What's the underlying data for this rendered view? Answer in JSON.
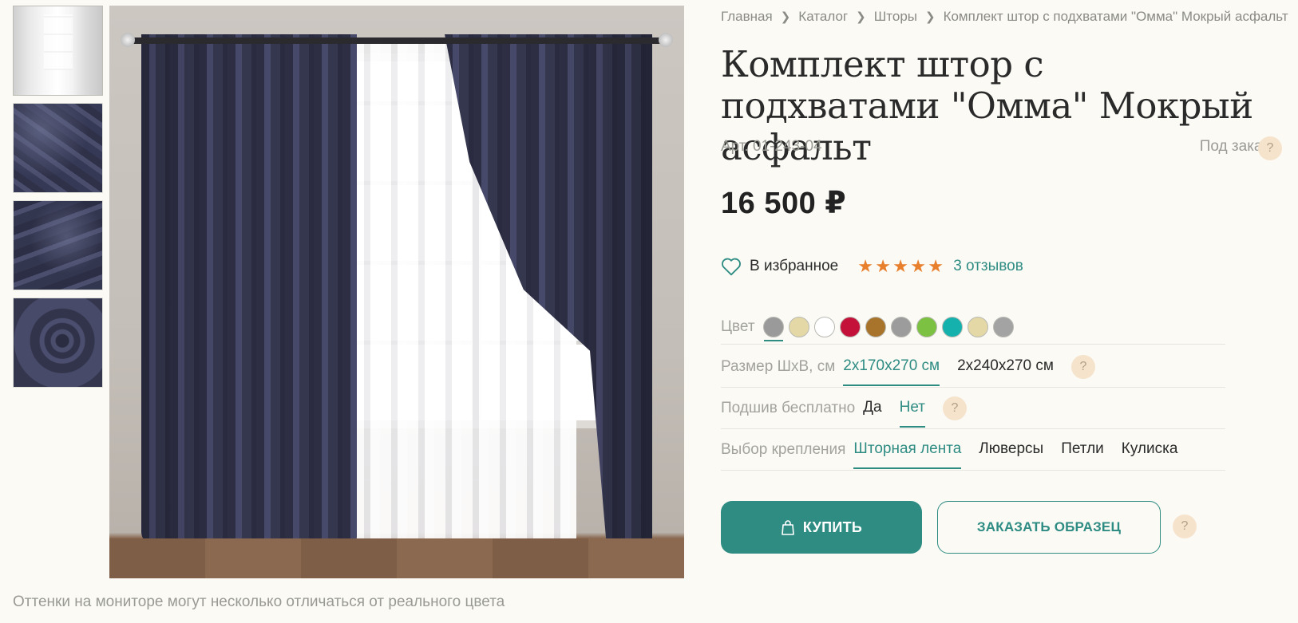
{
  "notice": "Оттенки на мониторе могут несколько отличаться от реального цвета",
  "breadcrumb": [
    {
      "label": "Главная"
    },
    {
      "label": "Каталог"
    },
    {
      "label": "Шторы"
    },
    {
      "label": "Комплект штор с подхватами \"Омма\" Мокрый асфальт"
    }
  ],
  "product": {
    "title": "Комплект штор с подхватами \"Омма\" Мокрый асфальт",
    "sku": "Арт. 01-243-04",
    "availability": "Под заказ",
    "price": "16 500 ₽",
    "favorite_label": "В избранное",
    "rating": 5,
    "reviews_label": "3 отзывов"
  },
  "help_glyph": "?",
  "options": {
    "color": {
      "label": "Цвет",
      "swatches": [
        "#9a9a9a",
        "#e4d8a6",
        "#ffffff",
        "#c3113a",
        "#a8742c",
        "#9c9c9c",
        "#7cc142",
        "#15b2ad",
        "#e4d8a6",
        "#a3a3a3"
      ]
    },
    "size": {
      "label": "Размер ШхВ, см",
      "values": [
        "2х170х270 см",
        "2х240х270 см"
      ],
      "selected": 0
    },
    "hem": {
      "label": "Подшив бесплатно",
      "values": [
        "Да",
        "Нет"
      ],
      "selected": 1
    },
    "mount": {
      "label": "Выбор крепления",
      "values": [
        "Шторная лента",
        "Люверсы",
        "Петли",
        "Кулиска"
      ],
      "selected": 0
    }
  },
  "actions": {
    "buy_label": "КУПИТЬ",
    "sample_label": "ЗАКАЗАТЬ ОБРАЗЕЦ"
  },
  "colors": {
    "accent": "#2e8c83",
    "star": "#e87f2c",
    "help_bg": "#f6e3cc"
  },
  "icons": {
    "favorite": "heart-outline-icon",
    "buy": "shopping-bag-icon",
    "help": "question-icon"
  }
}
